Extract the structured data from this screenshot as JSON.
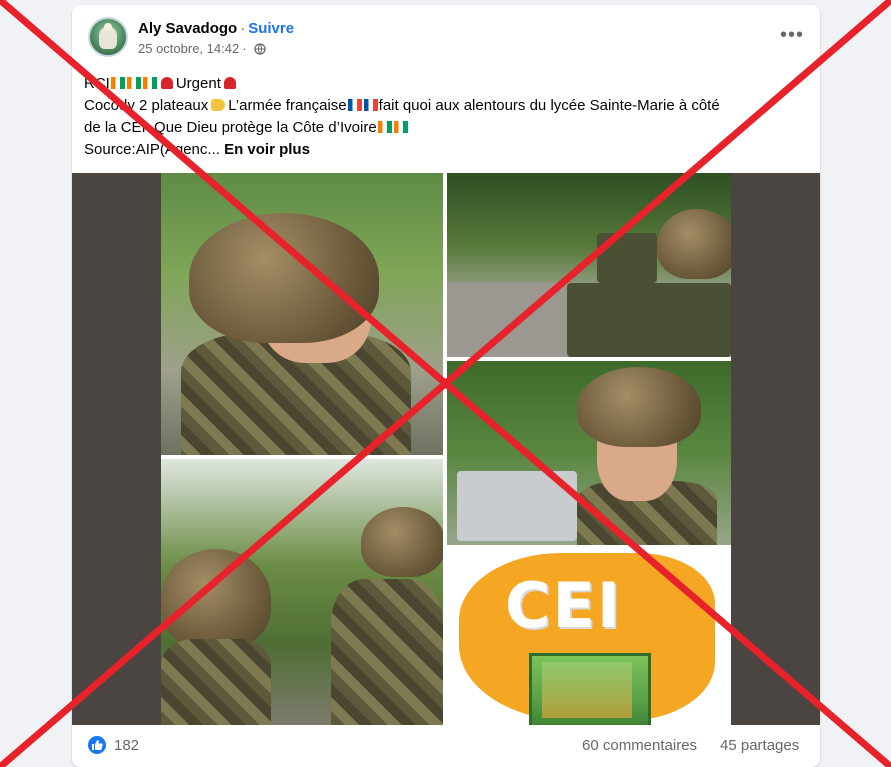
{
  "post": {
    "author": "Aly Savadogo",
    "separator": "·",
    "follow_label": "Suivre",
    "timestamp": "25 octobre, 14:42",
    "meta_separator": "·",
    "privacy_icon": "globe-icon",
    "more_label": "•••",
    "lines": {
      "line1_prefix": "RCI",
      "line1_label": "Urgent",
      "line2_prefix": "Cocody 2 plateaux",
      "line2_mid": "L’armée française",
      "line2_suffix": "fait quoi aux alentours du lycée Sainte-Marie à côté",
      "line3": "de la CEI ,Que Dieu protège la Côte d’Ivoire",
      "line4": "Source:AIP(Agenc...",
      "see_more": "En voir plus"
    },
    "image": {
      "logo_text": "CEI"
    },
    "stats": {
      "reactions": "182",
      "comments": "60 commentaires",
      "shares": "45 partages"
    }
  },
  "overlay": {
    "color": "#e8222b",
    "meaning": "red-x-cross-out"
  },
  "colors": {
    "accent": "#1b74e4",
    "like": "#1877f2",
    "background": "#f0f2f5"
  }
}
